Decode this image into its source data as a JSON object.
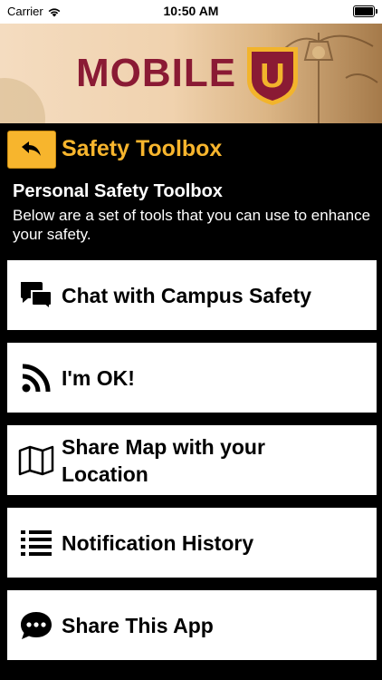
{
  "status_bar": {
    "carrier": "Carrier",
    "time": "10:50 AM"
  },
  "banner": {
    "logo_text": "MOBILE",
    "logo_badge": "U",
    "brand_color": "#8a1a34"
  },
  "nav": {
    "title": "Safety Toolbox",
    "accent_color": "#f7b52d"
  },
  "intro": {
    "heading": "Personal Safety Toolbox",
    "description": "Below are a set of tools that you can use to enhance your safety."
  },
  "tools": [
    {
      "label": "Chat with Campus Safety",
      "icon": "chat-bubbles-icon"
    },
    {
      "label": "I'm OK!",
      "icon": "rss-feed-icon"
    },
    {
      "label": "Share Map with your Location",
      "icon": "map-icon"
    },
    {
      "label": "Notification History",
      "icon": "list-icon"
    },
    {
      "label": "Share This App",
      "icon": "speech-bubble-icon"
    }
  ]
}
